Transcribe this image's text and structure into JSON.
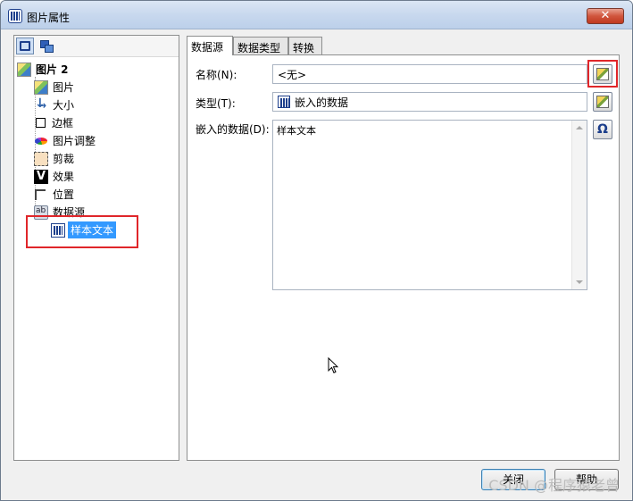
{
  "window": {
    "title": "图片属性",
    "close_label": "✕"
  },
  "tree": {
    "root": "图片 2",
    "items": [
      {
        "label": "图片",
        "icon": "picture-icon"
      },
      {
        "label": "大小",
        "icon": "size-icon"
      },
      {
        "label": "边框",
        "icon": "border-icon"
      },
      {
        "label": "图片调整",
        "icon": "color-adjust-icon"
      },
      {
        "label": "剪裁",
        "icon": "crop-icon"
      },
      {
        "label": "效果",
        "icon": "effect-icon"
      },
      {
        "label": "位置",
        "icon": "position-icon"
      },
      {
        "label": "数据源",
        "icon": "datasource-icon"
      }
    ],
    "selected_child": "样本文本"
  },
  "tabs": [
    {
      "label": "数据源",
      "active": true
    },
    {
      "label": "数据类型",
      "active": false
    },
    {
      "label": "转换",
      "active": false
    }
  ],
  "form": {
    "name_label": "名称(N):",
    "name_value": "<无>",
    "type_label": "类型(T):",
    "type_value": "嵌入的数据",
    "embedded_label": "嵌入的数据(D):",
    "embedded_value": "样本文本"
  },
  "buttons": {
    "close": "关闭",
    "help": "帮助"
  },
  "watermark": "CSDN @程序猿老曾",
  "colors": {
    "highlight_red": "#e0262a",
    "selection_blue": "#3399ff"
  }
}
